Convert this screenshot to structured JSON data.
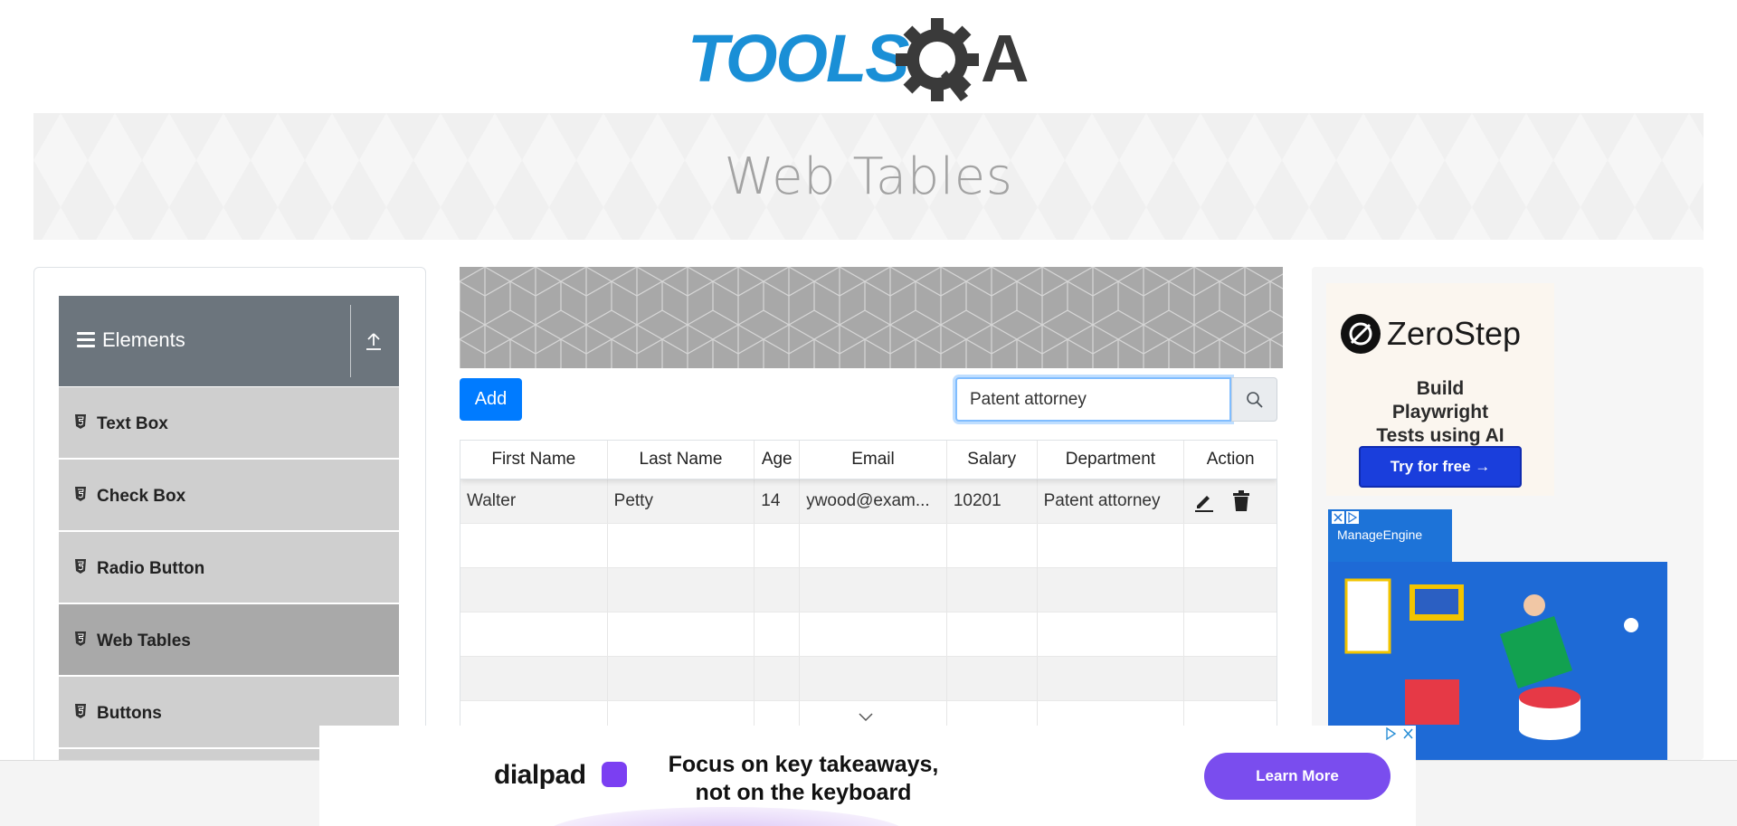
{
  "header": {
    "logo_text": "TOOLSQA",
    "page_title": "Web Tables"
  },
  "sidebar": {
    "group_title": "Elements",
    "items": [
      {
        "label": "Text Box"
      },
      {
        "label": "Check Box"
      },
      {
        "label": "Radio Button"
      },
      {
        "label": "Web Tables",
        "active": true
      },
      {
        "label": "Buttons"
      }
    ]
  },
  "toolbar": {
    "add_label": "Add",
    "search_value": "Patent attorney"
  },
  "table": {
    "columns": [
      "First Name",
      "Last Name",
      "Age",
      "Email",
      "Salary",
      "Department",
      "Action"
    ],
    "rows": [
      {
        "first": "Walter",
        "last": "Petty",
        "age": "14",
        "email": "ywood@exam...",
        "salary": "10201",
        "department": "Patent attorney"
      }
    ],
    "empty_rows": 4
  },
  "right_ad": {
    "brand": "ZeroStep",
    "headline": "Build Playwright Tests using AI",
    "cta": "Try for free →",
    "second_brand": "ManageEngine"
  },
  "bottom_ad": {
    "brand": "dialpad",
    "line1": "Focus on key takeaways,",
    "line2": "not on the keyboard",
    "cta": "Learn More"
  },
  "colors": {
    "primary": "#007bff",
    "toolsqa_blue": "#1a8fd6",
    "sidebar_header": "#6c757d",
    "menu_item": "#cfcfcf",
    "menu_active": "#a9a9a9",
    "zerostep_button": "#1a3edc",
    "dialpad_purple": "#7a4dee"
  }
}
